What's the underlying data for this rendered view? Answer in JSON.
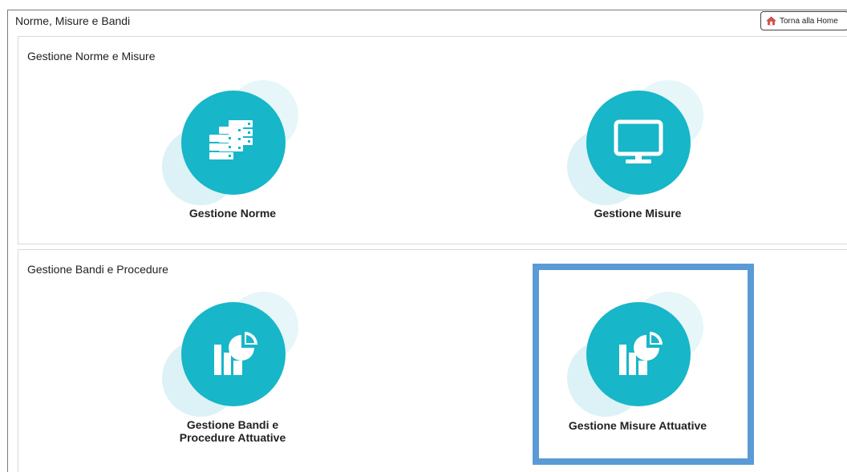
{
  "header": {
    "title": "Norme, Misure e Bandi",
    "home_button": "Torna alla Home"
  },
  "sections": [
    {
      "title": "Gestione Norme e Misure",
      "tiles": [
        {
          "label": "Gestione Norme",
          "icon": "server-stack-icon"
        },
        {
          "label": "Gestione Misure",
          "icon": "monitor-icon"
        }
      ]
    },
    {
      "title": "Gestione Bandi e Procedure",
      "tiles": [
        {
          "label_line1": "Gestione Bandi e",
          "label_line2": "Procedure Attuative",
          "icon": "chart-report-icon"
        },
        {
          "label": "Gestione Misure Attuative",
          "icon": "chart-report-icon",
          "selected": true
        }
      ]
    }
  ],
  "colors": {
    "accent": "#17b6c8",
    "bubble": "#dff3f7",
    "highlight": "#5b9bd5"
  }
}
